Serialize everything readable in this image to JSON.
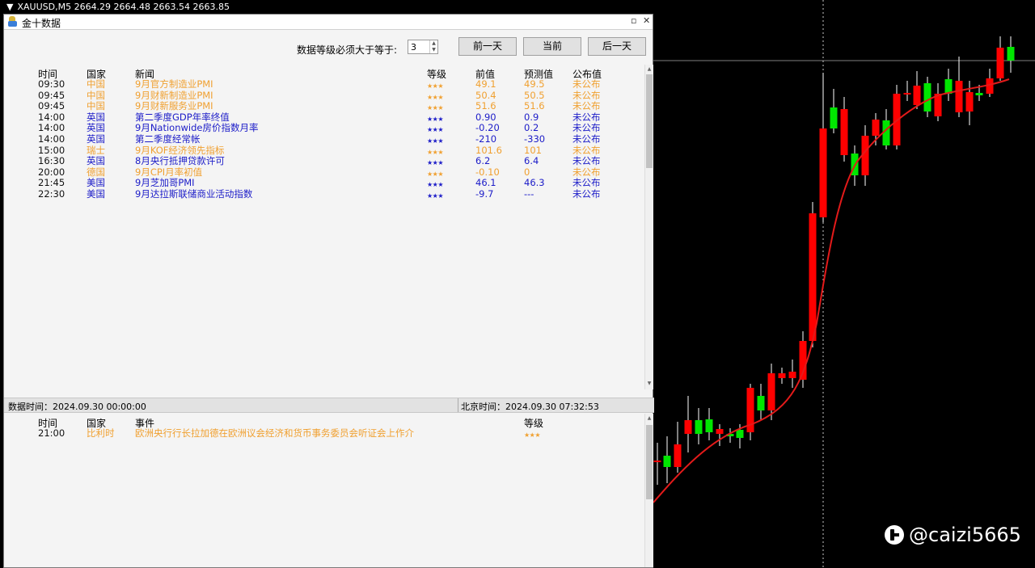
{
  "chart": {
    "title": "XAUUSD,M5  2664.29 2664.48 2663.54 2663.85",
    "watermark": "@caizi5665",
    "colors": {
      "bull": "#00e600",
      "bear": "#ff0000",
      "ma": "#e31a1a",
      "bg": "#000000"
    }
  },
  "panel": {
    "title": "金十数据",
    "level_label": "数据等级必须大于等于:",
    "level_value": "3",
    "buttons": {
      "prev": "前一天",
      "current": "当前",
      "next": "后一天"
    }
  },
  "events_table": {
    "headers": {
      "time": "时间",
      "country": "国家",
      "news": "新闻",
      "level": "等级",
      "prev": "前值",
      "forecast": "预测值",
      "published": "公布值"
    },
    "rows": [
      {
        "time": "09:30",
        "country": "中国",
        "news": "9月官方制造业PMI",
        "stars": "★★★",
        "prev": "49.1",
        "forecast": "49.5",
        "published": "未公布",
        "color": "orange"
      },
      {
        "time": "09:45",
        "country": "中国",
        "news": "9月财新制造业PMI",
        "stars": "★★★",
        "prev": "50.4",
        "forecast": "50.5",
        "published": "未公布",
        "color": "orange"
      },
      {
        "time": "09:45",
        "country": "中国",
        "news": "9月财新服务业PMI",
        "stars": "★★★",
        "prev": "51.6",
        "forecast": "51.6",
        "published": "未公布",
        "color": "orange"
      },
      {
        "time": "14:00",
        "country": "英国",
        "news": "第二季度GDP年率终值",
        "stars": "★★★",
        "prev": "0.90",
        "forecast": "0.9",
        "published": "未公布",
        "color": "blue"
      },
      {
        "time": "14:00",
        "country": "英国",
        "news": "9月Nationwide房价指数月率",
        "stars": "★★★",
        "prev": "-0.20",
        "forecast": "0.2",
        "published": "未公布",
        "color": "blue"
      },
      {
        "time": "14:00",
        "country": "英国",
        "news": "第二季度经常帐",
        "stars": "★★★",
        "prev": "-210",
        "forecast": "-330",
        "published": "未公布",
        "color": "blue"
      },
      {
        "time": "15:00",
        "country": "瑞士",
        "news": "9月KOF经济领先指标",
        "stars": "★★★",
        "prev": "101.6",
        "forecast": "101",
        "published": "未公布",
        "color": "orange"
      },
      {
        "time": "16:30",
        "country": "英国",
        "news": "8月央行抵押贷款许可",
        "stars": "★★★",
        "prev": "6.2",
        "forecast": "6.4",
        "published": "未公布",
        "color": "blue"
      },
      {
        "time": "20:00",
        "country": "德国",
        "news": "9月CPI月率初值",
        "stars": "★★★",
        "prev": "-0.10",
        "forecast": "0",
        "published": "未公布",
        "color": "orange"
      },
      {
        "time": "21:45",
        "country": "美国",
        "news": "9月芝加哥PMI",
        "stars": "★★★",
        "prev": "46.1",
        "forecast": "46.3",
        "published": "未公布",
        "color": "blue"
      },
      {
        "time": "22:30",
        "country": "美国",
        "news": "9月达拉斯联储商业活动指数",
        "stars": "★★★",
        "prev": "-9.7",
        "forecast": "---",
        "published": "未公布",
        "color": "blue"
      }
    ]
  },
  "status": {
    "data_time": "数据时间：2024.09.30 00:00:00",
    "beijing_time": "北京时间：2024.09.30 07:32:53"
  },
  "speech_table": {
    "headers": {
      "time": "时间",
      "country": "国家",
      "event": "事件",
      "level": "等级"
    },
    "rows": [
      {
        "time": "21:00",
        "country": "比利时",
        "event": "欧洲央行行长拉加德在欧洲议会经济和货币事务委员会听证会上作介",
        "stars": "★★★",
        "color": "orange"
      }
    ]
  }
}
